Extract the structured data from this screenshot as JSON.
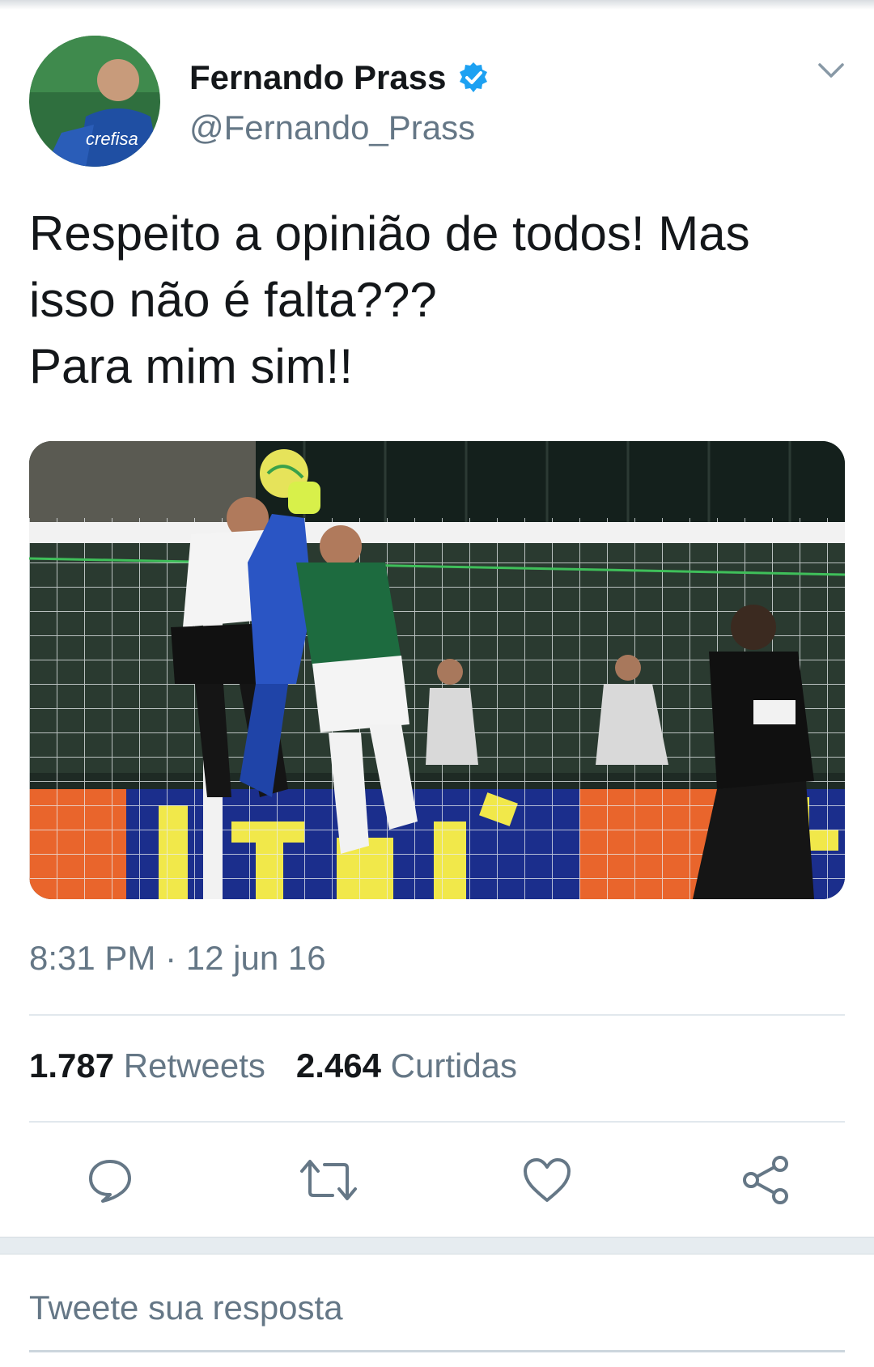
{
  "tweet": {
    "author_name": "Fernando Prass",
    "handle": "@Fernando_Prass",
    "verified": true,
    "text_lines": [
      "Respeito a opinião de todos! Mas",
      "isso não é falta???",
      "Para mim sim!!"
    ],
    "timestamp": "8:31 PM · 12 jun 16",
    "retweets_count": "1.787",
    "retweets_label": "Retweets",
    "likes_count": "2.464",
    "likes_label": "Curtidas"
  },
  "reply_box": {
    "placeholder": "Tweete sua resposta"
  },
  "actions": [
    {
      "icon": "reply-icon"
    },
    {
      "icon": "retweet-icon"
    },
    {
      "icon": "like-icon"
    },
    {
      "icon": "share-icon"
    }
  ],
  "colors": {
    "primary_text": "#14171a",
    "secondary_text": "#657786",
    "verified_blue": "#1da1f2",
    "divider": "#e1e8ed"
  }
}
